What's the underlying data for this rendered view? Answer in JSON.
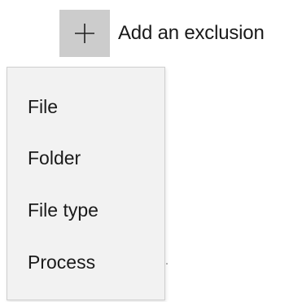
{
  "add_exclusion": {
    "label": "Add an exclusion",
    "icon": "plus-icon"
  },
  "menu": {
    "items": [
      {
        "label": "File"
      },
      {
        "label": "Folder"
      },
      {
        "label": "File type"
      },
      {
        "label": "Process"
      }
    ]
  },
  "colors": {
    "button_background": "#cccccc",
    "menu_background": "#f2f2f2",
    "text": "#1a1a1a"
  }
}
